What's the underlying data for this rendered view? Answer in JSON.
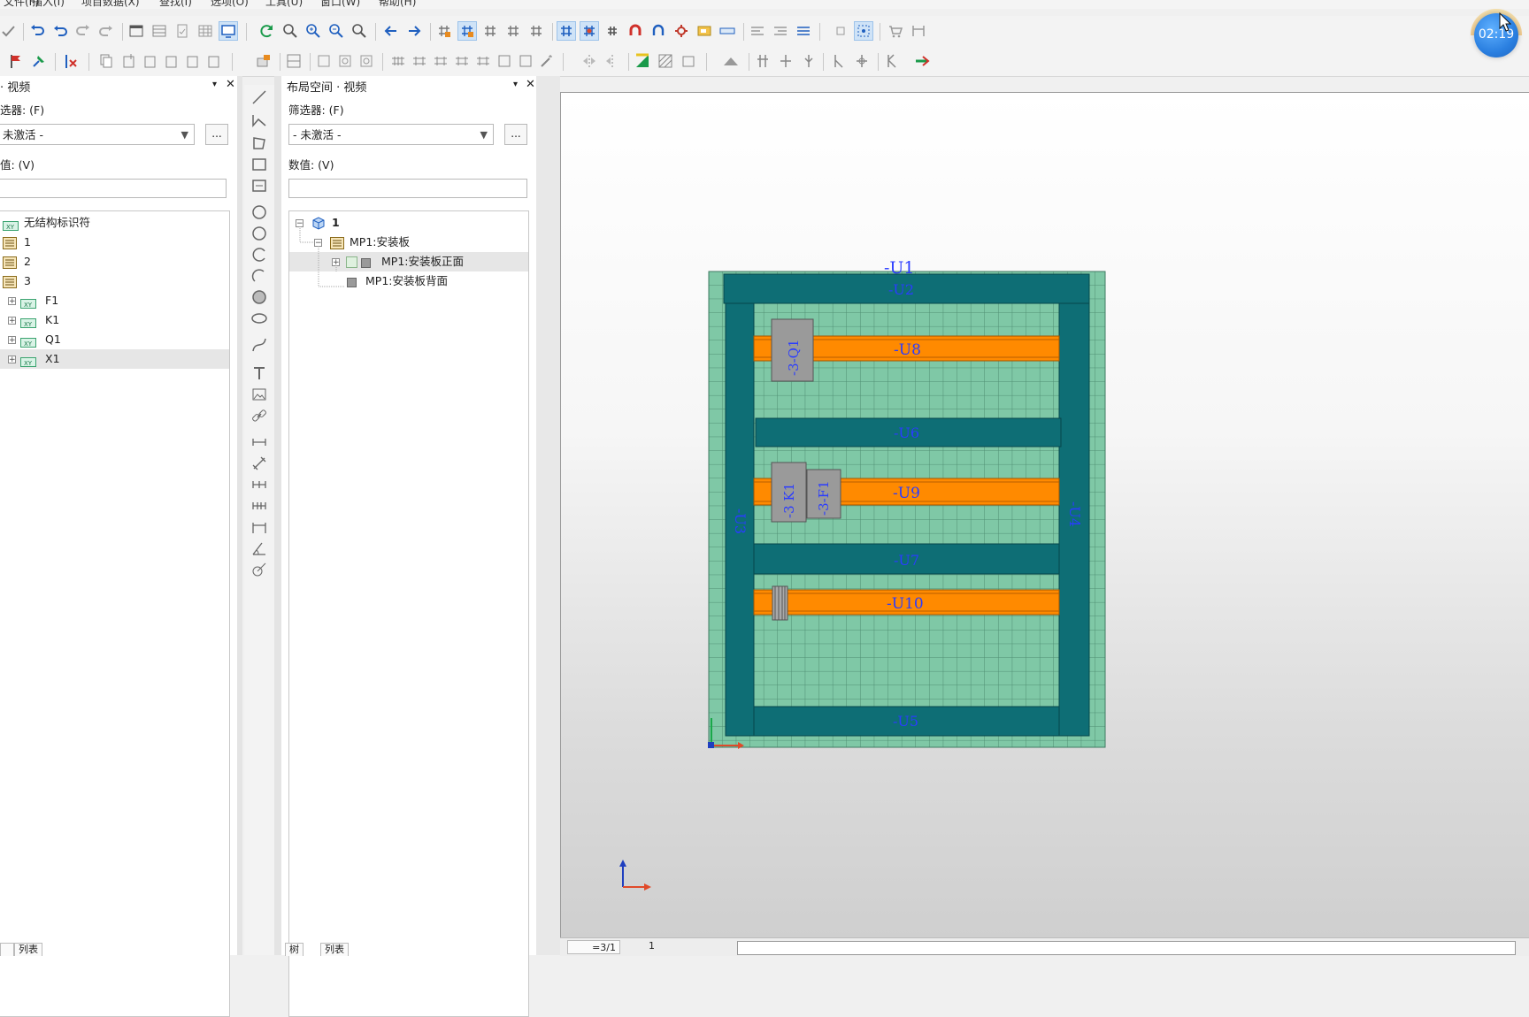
{
  "menu": [
    "文件(F)",
    "插入(I)",
    "项目数据(X)",
    "查找(I)",
    "选项(O)",
    "工具(U)",
    "窗口(W)",
    "帮助(H)"
  ],
  "timer": {
    "text": "02:19"
  },
  "left_panel": {
    "title": "· 视频",
    "filter_label": "选器: (F)",
    "filter_value": "未激活 -",
    "value_label": "值: (V)",
    "more": "...",
    "tree": [
      {
        "label": "无结构标识符",
        "icon": "xy-icon"
      },
      {
        "label": "1",
        "icon": "list-icon"
      },
      {
        "label": "2",
        "icon": "list-icon"
      },
      {
        "label": "3",
        "icon": "list-icon"
      },
      {
        "label": "F1",
        "icon": "xy-icon"
      },
      {
        "label": "K1",
        "icon": "xy-icon"
      },
      {
        "label": "Q1",
        "icon": "xy-icon"
      },
      {
        "label": "X1",
        "icon": "xy-icon"
      }
    ],
    "tabs": [
      "",
      "列表"
    ]
  },
  "mid_panel": {
    "title": "布局空间 · 视频",
    "filter_label": "筛选器: (F)",
    "filter_value": "- 未激活 -",
    "value_label": "数值: (V)",
    "more": "...",
    "tree": [
      {
        "label": "1",
        "icon": "cube-icon"
      },
      {
        "label": "MP1:安装板",
        "icon": "plate-icon"
      },
      {
        "label": "MP1:安装板正面",
        "icon": "face-icon"
      },
      {
        "label": "MP1:安装板背面",
        "icon": "face-icon"
      }
    ],
    "tabs": [
      "树",
      "列表"
    ]
  },
  "canvas": {
    "labels": {
      "u1": "-U1",
      "u2": "-U2",
      "u8": "-U8",
      "u6": "-U6",
      "u9": "-U9",
      "u7": "-U7",
      "u10": "-U10",
      "u5": "-U5",
      "u3": "-U3",
      "u4": "-U4",
      "q1": "-3-Q1",
      "k1": "-3 K1",
      "f1": "-3-F1"
    }
  },
  "status": {
    "page": "=3/1",
    "scale": "1"
  },
  "colors": {
    "grid": "#7fc8a6",
    "duct": "#0e6e75",
    "rail": "#ff8a00",
    "device": "#9a9a9a"
  }
}
